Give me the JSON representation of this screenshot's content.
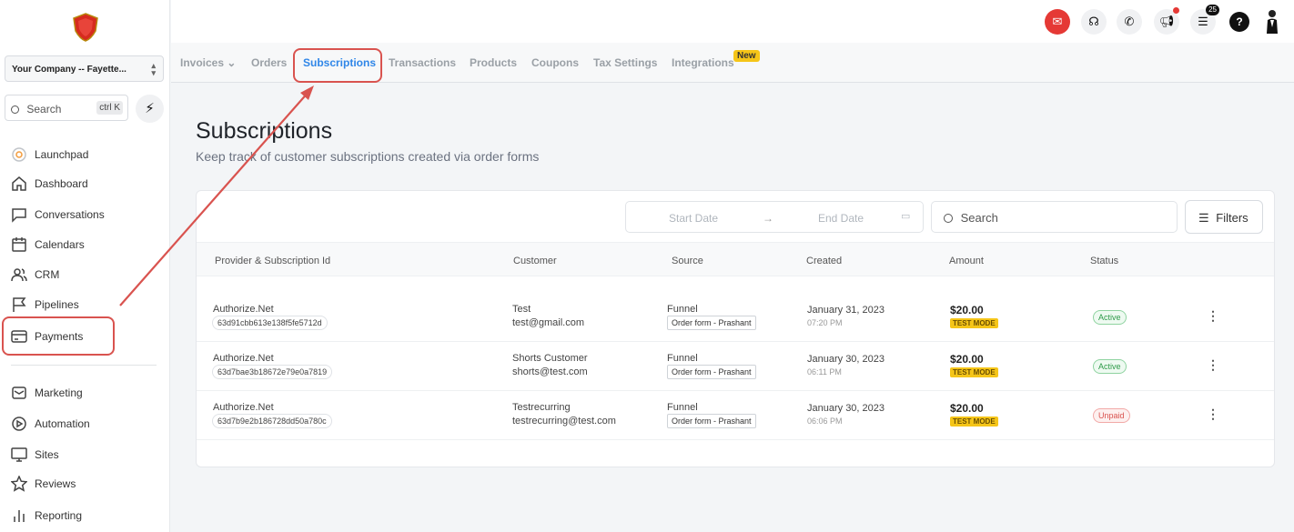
{
  "sidebar": {
    "company": "Your Company -- Fayette...",
    "search_placeholder": "Search",
    "search_shortcut": "ctrl K",
    "items": [
      {
        "label": "Launchpad",
        "icon": "launchpad-icon"
      },
      {
        "label": "Dashboard",
        "icon": "home-icon"
      },
      {
        "label": "Conversations",
        "icon": "chat-icon"
      },
      {
        "label": "Calendars",
        "icon": "calendar-icon"
      },
      {
        "label": "CRM",
        "icon": "users-icon"
      },
      {
        "label": "Pipelines",
        "icon": "flag-icon"
      },
      {
        "label": "Payments",
        "icon": "card-icon"
      },
      {
        "label": "Marketing",
        "icon": "mail-icon"
      },
      {
        "label": "Automation",
        "icon": "play-icon"
      },
      {
        "label": "Sites",
        "icon": "monitor-icon"
      },
      {
        "label": "Reviews",
        "icon": "star-icon"
      },
      {
        "label": "Reporting",
        "icon": "bar-chart-icon"
      }
    ]
  },
  "topbar": {
    "notification_count": "25",
    "icons": [
      "app-icon",
      "support-icon",
      "phone-icon",
      "announcement-icon",
      "tasks-icon",
      "help-icon",
      "user-avatar"
    ]
  },
  "tabs": {
    "items": [
      "Invoices",
      "Orders",
      "Subscriptions",
      "Transactions",
      "Products",
      "Coupons",
      "Tax Settings",
      "Integrations"
    ],
    "active": "Subscriptions",
    "new_badge": "New"
  },
  "page": {
    "title": "Subscriptions",
    "subtitle": "Keep track of customer subscriptions created via order forms"
  },
  "filters": {
    "start_date": "Start Date",
    "end_date": "End Date",
    "search_placeholder": "Search",
    "filters_label": "Filters"
  },
  "table": {
    "headers": [
      "Provider & Subscription Id",
      "Customer",
      "Source",
      "Created",
      "Amount",
      "Status"
    ],
    "rows": [
      {
        "provider": "Authorize.Net",
        "sub_id": "63d91cbb613e138f5fe5712d",
        "customer_name": "Test",
        "customer_email": "test@gmail.com",
        "source": "Funnel",
        "source_detail": "Order form - Prashant",
        "date": "January 31, 2023",
        "time": "07:20 PM",
        "amount": "$20.00",
        "mode": "TEST MODE",
        "status": "Active"
      },
      {
        "provider": "Authorize.Net",
        "sub_id": "63d7bae3b18672e79e0a7819",
        "customer_name": "Shorts Customer",
        "customer_email": "shorts@test.com",
        "source": "Funnel",
        "source_detail": "Order form - Prashant",
        "date": "January 30, 2023",
        "time": "06:11 PM",
        "amount": "$20.00",
        "mode": "TEST MODE",
        "status": "Active"
      },
      {
        "provider": "Authorize.Net",
        "sub_id": "63d7b9e2b186728dd50a780c",
        "customer_name": "Testrecurring",
        "customer_email": "testrecurring@test.com",
        "source": "Funnel",
        "source_detail": "Order form - Prashant",
        "date": "January 30, 2023",
        "time": "06:06 PM",
        "amount": "$20.00",
        "mode": "TEST MODE",
        "status": "Unpaid"
      }
    ]
  },
  "colors": {
    "accent": "#2f86e8",
    "highlight": "#d9534f",
    "active": "#2e9a49",
    "unpaid": "#d9534f",
    "test_mode": "#f5c518"
  }
}
